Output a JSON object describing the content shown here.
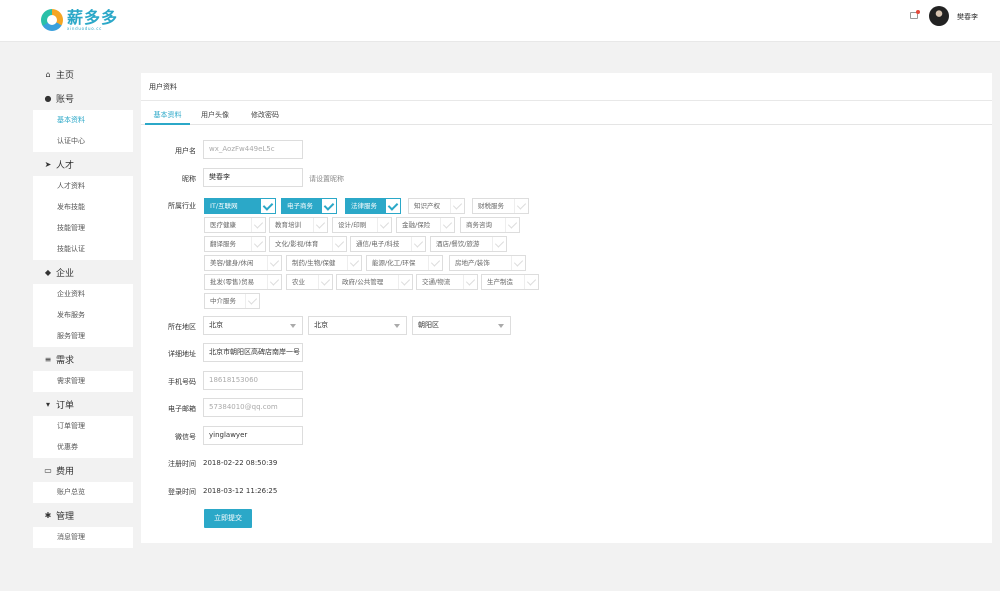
{
  "header": {
    "logo_cn": "薪多多",
    "logo_en": "xinduoduo.cc",
    "username": "樊春李",
    "brand_color": "#2ba8c8"
  },
  "sidebar": {
    "sections": [
      {
        "title": "主页",
        "icon": "home-icon",
        "items": []
      },
      {
        "title": "账号",
        "icon": "user-icon",
        "items": [
          {
            "label": "基本资料",
            "active": true
          },
          {
            "label": "认证中心"
          }
        ]
      },
      {
        "title": "人才",
        "icon": "send-icon",
        "items": [
          {
            "label": "人才资料"
          },
          {
            "label": "发布技能"
          },
          {
            "label": "技能管理"
          },
          {
            "label": "技能认证"
          }
        ]
      },
      {
        "title": "企业",
        "icon": "cube-icon",
        "items": [
          {
            "label": "企业资料"
          },
          {
            "label": "发布服务"
          },
          {
            "label": "服务管理"
          }
        ]
      },
      {
        "title": "需求",
        "icon": "list-icon",
        "items": [
          {
            "label": "需求管理"
          }
        ]
      },
      {
        "title": "订单",
        "icon": "cart-icon",
        "items": [
          {
            "label": "订单管理"
          },
          {
            "label": "优惠券"
          }
        ]
      },
      {
        "title": "费用",
        "icon": "card-icon",
        "items": [
          {
            "label": "账户总览"
          }
        ]
      },
      {
        "title": "管理",
        "icon": "gears-icon",
        "items": [
          {
            "label": "消息管理"
          }
        ]
      }
    ]
  },
  "panel": {
    "title": "用户资料",
    "tabs": [
      "基本资料",
      "用户头像",
      "修改密码"
    ],
    "active_tab": 0
  },
  "form": {
    "username": {
      "label": "用户名",
      "value": "wx_AozFw449eL5c"
    },
    "nickname": {
      "label": "昵称",
      "value": "樊春李",
      "hint": "请设置昵称"
    },
    "industry": {
      "label": "所属行业",
      "tags": [
        {
          "text": "IT/互联网",
          "checked": true
        },
        {
          "text": "电子商务",
          "checked": true
        },
        {
          "text": "法律服务",
          "checked": true
        },
        {
          "text": "知识产权",
          "checked": false
        },
        {
          "text": "财税服务",
          "checked": false
        },
        {
          "text": "医疗健康",
          "checked": false
        },
        {
          "text": "教育培训",
          "checked": false
        },
        {
          "text": "设计/印刷",
          "checked": false
        },
        {
          "text": "金融/保险",
          "checked": false
        },
        {
          "text": "商务咨询",
          "checked": false
        },
        {
          "text": "翻译服务",
          "checked": false
        },
        {
          "text": "文化/影视/体育",
          "checked": false
        },
        {
          "text": "通信/电子/科技",
          "checked": false
        },
        {
          "text": "酒店/餐饮/旅游",
          "checked": false
        },
        {
          "text": "美容/健身/休闲",
          "checked": false
        },
        {
          "text": "制药/生物/保健",
          "checked": false
        },
        {
          "text": "能源/化工/环保",
          "checked": false
        },
        {
          "text": "房地产/装饰",
          "checked": false
        },
        {
          "text": "批发(零售)贸易",
          "checked": false
        },
        {
          "text": "农业",
          "checked": false
        },
        {
          "text": "政府/公共管理",
          "checked": false
        },
        {
          "text": "交通/物流",
          "checked": false
        },
        {
          "text": "生产制造",
          "checked": false
        },
        {
          "text": "中介服务",
          "checked": false
        }
      ]
    },
    "region": {
      "label": "所在地区",
      "province": "北京",
      "city": "北京",
      "district": "朝阳区"
    },
    "address": {
      "label": "详细地址",
      "value": "北京市朝阳区高碑店南岸一号"
    },
    "phone": {
      "label": "手机号码",
      "value": "18618153060"
    },
    "email": {
      "label": "电子邮箱",
      "value": "57384010@qq.com"
    },
    "wechat": {
      "label": "微信号",
      "value": "yinglawyer"
    },
    "register_time": {
      "label": "注册时间",
      "value": "2018-02-22 08:50:39"
    },
    "login_time": {
      "label": "登录时间",
      "value": "2018-03-12 11:26:25"
    },
    "submit_label": "立即提交"
  }
}
